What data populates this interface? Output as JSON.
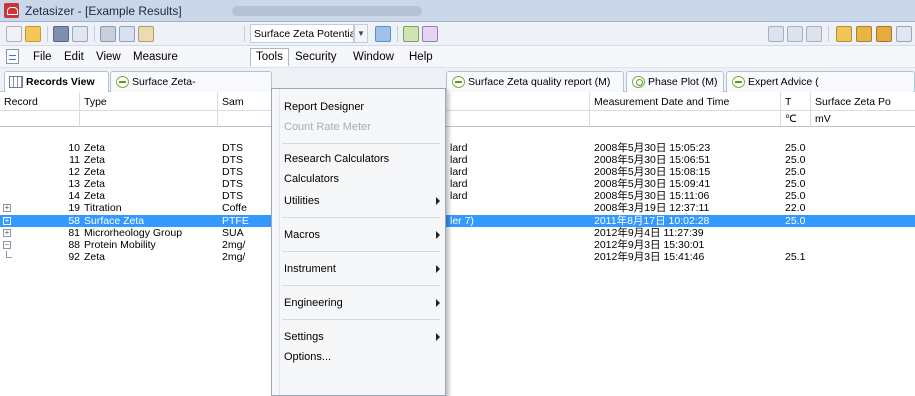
{
  "window": {
    "title": "Zetasizer - [Example Results]"
  },
  "toolbar": {
    "combo_value": "Surface Zeta Potential"
  },
  "menubar": {
    "items": [
      {
        "label": "File",
        "open": false
      },
      {
        "label": "Edit",
        "open": false
      },
      {
        "label": "View",
        "open": false
      },
      {
        "label": "Measure",
        "open": false
      },
      {
        "label": "Tools",
        "open": true
      },
      {
        "label": "Security",
        "open": false
      },
      {
        "label": "Window",
        "open": false
      },
      {
        "label": "Help",
        "open": false
      }
    ]
  },
  "tabs": [
    {
      "label": "Records View",
      "icon": "grid-icon",
      "active": true
    },
    {
      "label": "Surface Zeta-",
      "icon": "zeta-report-icon",
      "active": false
    },
    {
      "label": "Surface Zeta quality report (M)",
      "icon": "zeta-report-icon",
      "active": false
    },
    {
      "label": "Phase Plot (M)",
      "icon": "phase-plot-icon",
      "active": false
    },
    {
      "label": "Expert Advice (",
      "icon": "zeta-report-icon",
      "active": false
    }
  ],
  "grid": {
    "columns": [
      "Record",
      "Type",
      "Sam",
      "Measurement Date and Time",
      "T",
      "Surface Zeta Po"
    ],
    "units": {
      "t": "℃",
      "zeta": "mV"
    },
    "rows": [
      {
        "record": "10",
        "type": "Zeta",
        "sample": "DTS",
        "tail": "lard",
        "datetime": "2008年5月30日 15:05:23",
        "t": "25.0",
        "expander": "",
        "selected": false
      },
      {
        "record": "11",
        "type": "Zeta",
        "sample": "DTS",
        "tail": "lard",
        "datetime": "2008年5月30日 15:06:51",
        "t": "25.0",
        "expander": "",
        "selected": false
      },
      {
        "record": "12",
        "type": "Zeta",
        "sample": "DTS",
        "tail": "lard",
        "datetime": "2008年5月30日 15:08:15",
        "t": "25.0",
        "expander": "",
        "selected": false
      },
      {
        "record": "13",
        "type": "Zeta",
        "sample": "DTS",
        "tail": "lard",
        "datetime": "2008年5月30日 15:09:41",
        "t": "25.0",
        "expander": "",
        "selected": false
      },
      {
        "record": "14",
        "type": "Zeta",
        "sample": "DTS",
        "tail": "lard",
        "datetime": "2008年5月30日 15:11:06",
        "t": "25.0",
        "expander": "",
        "selected": false
      },
      {
        "record": "19",
        "type": "Titration",
        "sample": "Coffe",
        "tail": "",
        "datetime": "2008年3月19日 12:37:11",
        "t": "22.0",
        "expander": "+",
        "selected": false
      },
      {
        "record": "58",
        "type": "Surface Zeta",
        "sample": "PTFE",
        "tail": "ler 7)",
        "datetime": "2011年8月17日 10:02:28",
        "t": "25.0",
        "expander": "+",
        "selected": true
      },
      {
        "record": "81",
        "type": "Microrheology Group",
        "sample": "SUA",
        "tail": "",
        "datetime": "2012年9月4日 11:27:39",
        "t": "",
        "expander": "+",
        "selected": false
      },
      {
        "record": "88",
        "type": "Protein Mobility",
        "sample": "2mg/",
        "tail": "",
        "datetime": "2012年9月3日 15:30:01",
        "t": "",
        "expander": "−",
        "selected": false
      },
      {
        "record": "92",
        "type": "Zeta",
        "sample": "2mg/",
        "tail": "",
        "datetime": "2012年9月3日 15:41:46",
        "t": "25.1",
        "expander": "tree",
        "selected": false
      }
    ]
  },
  "tools_menu": {
    "items": [
      {
        "label": "Report Designer",
        "disabled": false,
        "submenu": false
      },
      {
        "label": "Count Rate Meter",
        "disabled": true,
        "submenu": false
      },
      {
        "label": "Research Calculators",
        "disabled": false,
        "submenu": false
      },
      {
        "label": "Calculators",
        "disabled": false,
        "submenu": false
      },
      {
        "label": "Utilities",
        "disabled": false,
        "submenu": true
      },
      {
        "label": "Macros",
        "disabled": false,
        "submenu": true
      },
      {
        "label": "Instrument",
        "disabled": false,
        "submenu": true
      },
      {
        "label": "Engineering",
        "disabled": false,
        "submenu": true
      },
      {
        "label": "Settings",
        "disabled": false,
        "submenu": true
      },
      {
        "label": "Options...",
        "disabled": false,
        "submenu": false
      }
    ]
  },
  "colors": {
    "selection": "#3399ff",
    "disabled_text": "#a7adb7",
    "brand_red": "#c9353a"
  }
}
